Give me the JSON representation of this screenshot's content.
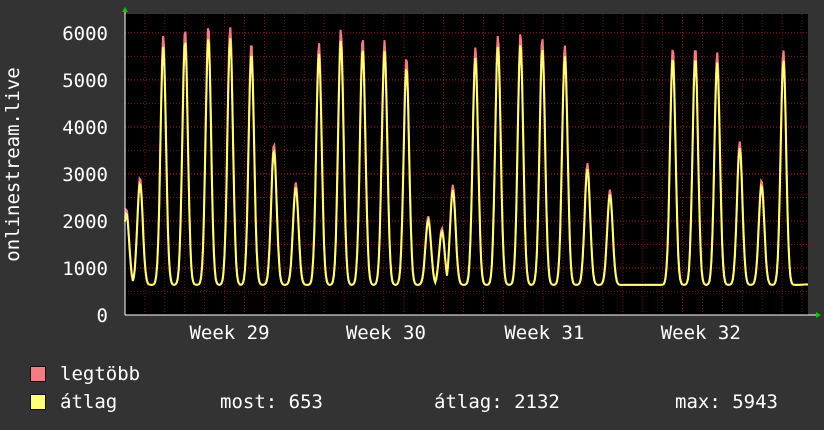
{
  "colors": {
    "background": "#333333",
    "plot_bg": "#000000",
    "grid": "#8b1a1a",
    "max_series": "#f07c84",
    "avg_series": "#ffff7a",
    "axis_arrow": "#00cc00"
  },
  "chart_data": {
    "type": "line",
    "ylabel": "onlinestream.live",
    "ylim": [
      0,
      6400
    ],
    "yticks": [
      0,
      1000,
      2000,
      3000,
      4000,
      5000,
      6000
    ],
    "xlim": [
      0,
      100
    ],
    "week_labels": [
      {
        "label": "Week 29",
        "x": 15.3
      },
      {
        "label": "Week 30",
        "x": 38.2
      },
      {
        "label": "Week 31",
        "x": 61.4
      },
      {
        "label": "Week 32",
        "x": 84.3
      }
    ],
    "peaks": [
      {
        "x": 0.2,
        "value": 2200
      },
      {
        "x": 2.2,
        "value": 2850
      },
      {
        "x": 5.6,
        "value": 5800
      },
      {
        "x": 8.8,
        "value": 5930
      },
      {
        "x": 12.2,
        "value": 6000
      },
      {
        "x": 15.4,
        "value": 5980
      },
      {
        "x": 18.5,
        "value": 5650
      },
      {
        "x": 21.8,
        "value": 3550
      },
      {
        "x": 25.0,
        "value": 2750
      },
      {
        "x": 28.4,
        "value": 5650
      },
      {
        "x": 31.6,
        "value": 5930
      },
      {
        "x": 34.8,
        "value": 5750
      },
      {
        "x": 38.0,
        "value": 5700
      },
      {
        "x": 41.2,
        "value": 5350
      },
      {
        "x": 44.4,
        "value": 2050
      },
      {
        "x": 46.4,
        "value": 1800
      },
      {
        "x": 48.0,
        "value": 2700
      },
      {
        "x": 51.3,
        "value": 5550
      },
      {
        "x": 54.6,
        "value": 5800
      },
      {
        "x": 57.9,
        "value": 5850
      },
      {
        "x": 61.1,
        "value": 5750
      },
      {
        "x": 64.4,
        "value": 5600
      },
      {
        "x": 67.7,
        "value": 3150
      },
      {
        "x": 71.0,
        "value": 2600
      },
      {
        "x": 73.6,
        "value": 600
      },
      {
        "x": 80.2,
        "value": 5550
      },
      {
        "x": 83.5,
        "value": 5550
      },
      {
        "x": 86.7,
        "value": 5450
      },
      {
        "x": 90.0,
        "value": 3600
      },
      {
        "x": 93.2,
        "value": 2800
      },
      {
        "x": 96.4,
        "value": 5500
      },
      {
        "x": 99.7,
        "value": 650
      }
    ],
    "series": [
      {
        "name": "legtöbb"
      },
      {
        "name": "átlag"
      }
    ]
  },
  "legend": {
    "max_label": "legtöbb",
    "avg_label": "átlag",
    "now_text": "most: 653",
    "avg_text": "átlag: 2132",
    "max_text": "max: 5943"
  }
}
